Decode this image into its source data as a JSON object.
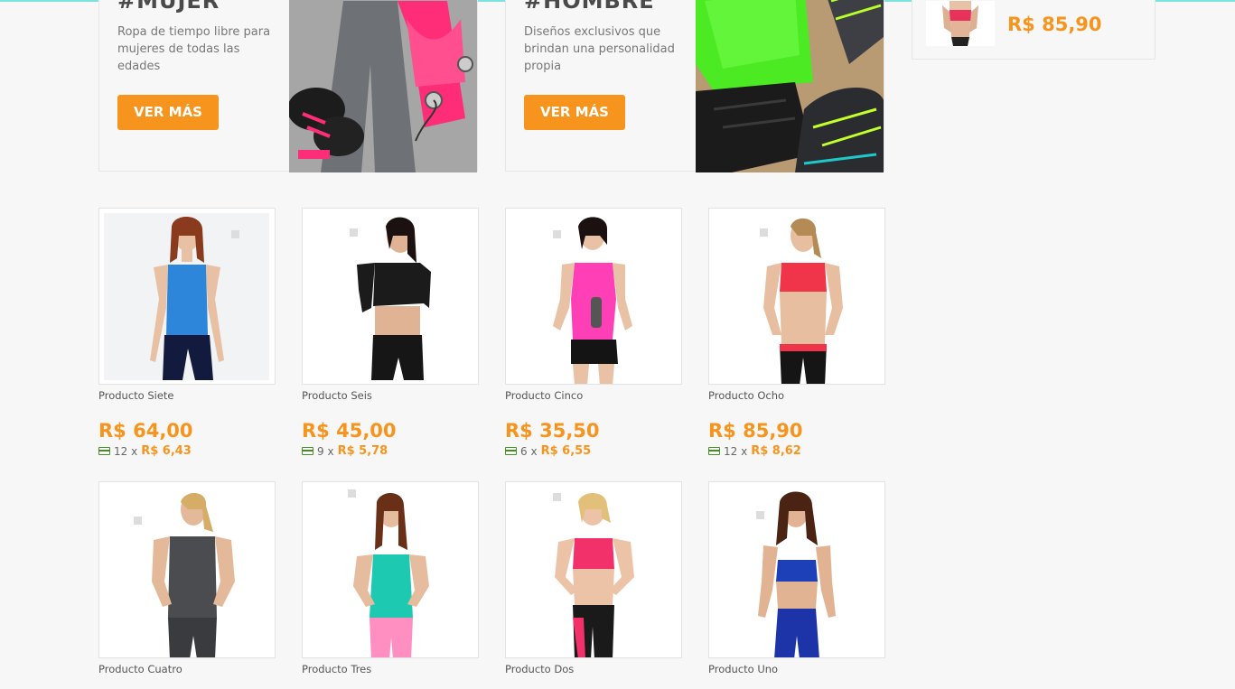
{
  "banners": [
    {
      "title": "#MUJER",
      "text": "Ropa de tiempo libre para mujeres de todas las edades",
      "button": "VER MÁS"
    },
    {
      "title": "#HOMBRE",
      "text": "Diseños exclusivos que brindan una personalidad propia",
      "button": "VER MÁS"
    }
  ],
  "mini_cart": {
    "price": "R$ 85,90"
  },
  "products": [
    {
      "name": "Producto Siete",
      "price": "R$ 64,00",
      "installments": "12 x",
      "installment_value": "R$ 6,43"
    },
    {
      "name": "Producto Seis",
      "price": "R$ 45,00",
      "installments": "9 x",
      "installment_value": "R$ 5,78"
    },
    {
      "name": "Producto Cinco",
      "price": "R$ 35,50",
      "installments": "6 x",
      "installment_value": "R$ 6,55"
    },
    {
      "name": "Producto Ocho",
      "price": "R$ 85,90",
      "installments": "12 x",
      "installment_value": "R$ 8,62"
    },
    {
      "name": "Producto Cuatro"
    },
    {
      "name": "Producto Tres"
    },
    {
      "name": "Producto Dos"
    },
    {
      "name": "Producto Uno"
    }
  ],
  "colors": {
    "accent": "#f7941d",
    "card_icon": "#4a8c2a",
    "top_line": "#7de3e0"
  }
}
